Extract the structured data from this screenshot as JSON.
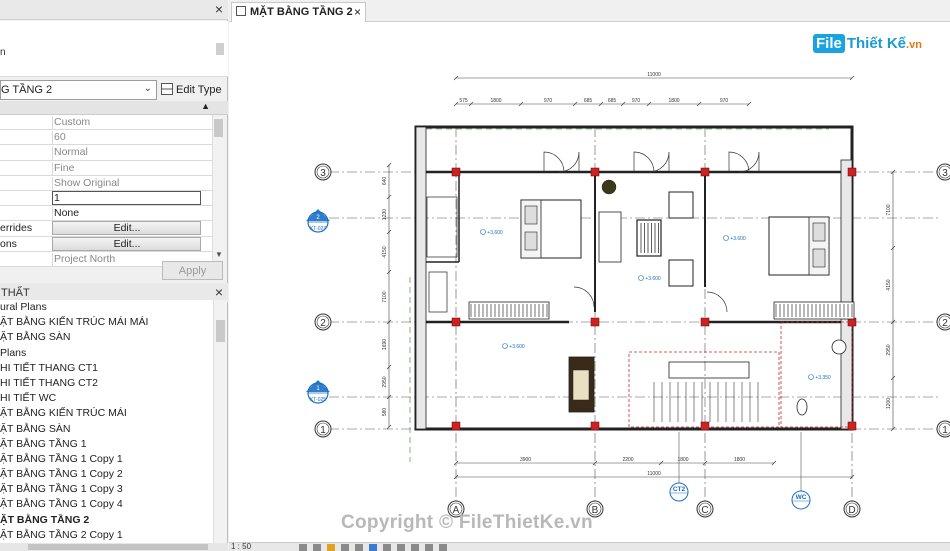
{
  "properties": {
    "type_area_label": "n",
    "type_selected": "G TẦNG 2",
    "edit_type_label": "Edit Type",
    "rows": [
      {
        "key": "",
        "value": "Custom",
        "style": "grey"
      },
      {
        "key": "",
        "value": "60",
        "style": "grey"
      },
      {
        "key": "",
        "value": "Normal",
        "style": "grey"
      },
      {
        "key": "",
        "value": "Fine",
        "style": "grey"
      },
      {
        "key": "",
        "value": "Show Original",
        "style": "grey"
      },
      {
        "key": "",
        "value": "1",
        "style": "input"
      },
      {
        "key": "",
        "value": "None",
        "style": "dark"
      },
      {
        "key": "errides",
        "value": "Edit...",
        "style": "btn"
      },
      {
        "key": "ons",
        "value": "Edit...",
        "style": "btn"
      },
      {
        "key": "",
        "value": "Project North",
        "style": "grey"
      }
    ],
    "apply_label": "Apply"
  },
  "browser": {
    "title": "THẤT",
    "items": [
      {
        "label": "ural Plans",
        "selected": false
      },
      {
        "label": "ẶT BẰNG KIẾN TRÚC MÁI MÁI",
        "selected": false
      },
      {
        "label": "ẶT BẰNG SÀN",
        "selected": false
      },
      {
        "label": "Plans",
        "selected": false
      },
      {
        "label": "HI TIẾT THANG CT1",
        "selected": false
      },
      {
        "label": "HI TIẾT THANG CT2",
        "selected": false
      },
      {
        "label": "HI TIẾT WC",
        "selected": false
      },
      {
        "label": "ẶT BẰNG KIẾN TRÚC MÁI",
        "selected": false
      },
      {
        "label": "ẶT BẰNG SÀN",
        "selected": false
      },
      {
        "label": "ẶT BẰNG TẦNG 1",
        "selected": false
      },
      {
        "label": "ẶT BẰNG TẦNG 1 Copy 1",
        "selected": false
      },
      {
        "label": "ẶT BẰNG TẦNG 1 Copy 2",
        "selected": false
      },
      {
        "label": "ẶT BẰNG TẦNG 1 Copy 3",
        "selected": false
      },
      {
        "label": "ẶT BẰNG TẦNG 1 Copy 4",
        "selected": false
      },
      {
        "label": "ẶT BẰNG TẦNG 2",
        "selected": true
      },
      {
        "label": "ẶT BẰNG TẦNG 2 Copy 1",
        "selected": false
      }
    ]
  },
  "view": {
    "tab_label": "MẶT BẰNG TẦNG 2",
    "tab_close": "×",
    "panel_close": "×",
    "logo_file": "File",
    "logo_rest": "Thiết Kế",
    "logo_vn": ".vn",
    "watermark": "Copyright © FileThietKe.vn",
    "scale": "1 : 50",
    "grid_rows": [
      "3",
      "2",
      "1"
    ],
    "grid_cols": [
      "A",
      "B",
      "C",
      "D"
    ],
    "section_tags": [
      "2",
      "KT-027",
      "1",
      "KT-025"
    ],
    "detail_tags": [
      "CT2",
      "WC"
    ],
    "dims_top_total": "11000",
    "dims_top": [
      "575",
      "1800",
      "970",
      "685",
      "685",
      "970",
      "1800",
      "970"
    ],
    "dims_bottom": [
      "3900",
      "2200",
      "1800",
      "1800"
    ],
    "dims_bottom_total": "11000",
    "dims_left": [
      "640",
      "1230",
      "4150",
      "7100",
      "1690",
      "2950",
      "580"
    ],
    "dims_right": [
      "7100",
      "4150",
      "2950",
      "1200"
    ],
    "level_marks": [
      "+3.600",
      "+3.600",
      "+3.600",
      "+3.600",
      "+3.350"
    ]
  },
  "colors": {
    "accent_blue": "#1a6fc4",
    "column_red": "#cc2222",
    "wall": "#222222",
    "logo_blue": "#1aa3e0",
    "logo_orange": "#e07a10"
  }
}
